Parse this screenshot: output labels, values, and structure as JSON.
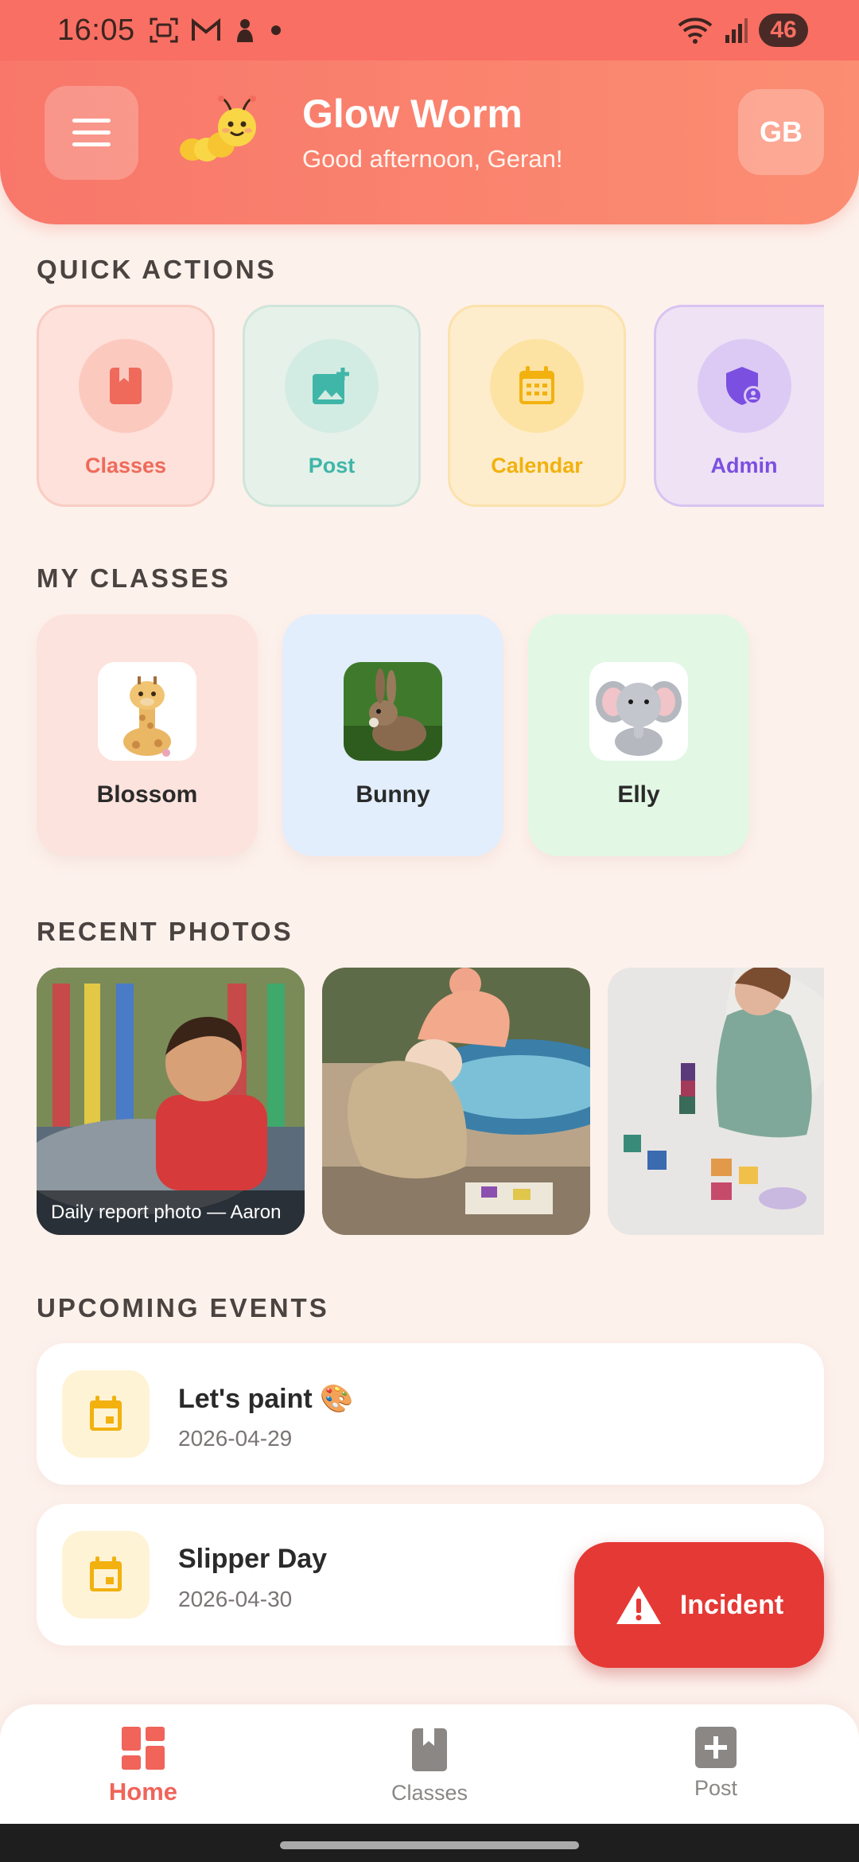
{
  "status": {
    "time": "16:05",
    "battery": "46",
    "icons": [
      "screenshot-icon",
      "gmail-icon",
      "notification-icon",
      "dot-icon",
      "wifi-icon",
      "signal-icon"
    ]
  },
  "header": {
    "app_title": "Glow Worm",
    "greeting": "Good afternoon, Geran!",
    "avatar_initials": "GB"
  },
  "sections": {
    "quick_actions": "QUICK ACTIONS",
    "my_classes": "MY CLASSES",
    "recent_photos": "RECENT PHOTOS",
    "upcoming_events": "UPCOMING EVENTS"
  },
  "quick_actions": [
    {
      "label": "Classes",
      "color": "#ef6a5b",
      "bg": "#fde1da",
      "circle": "#fcc9bf"
    },
    {
      "label": "Post",
      "color": "#3fb6a8",
      "bg": "#e6f1ea",
      "circle": "#d3ece3"
    },
    {
      "label": "Calendar",
      "color": "#f2b10e",
      "bg": "#fdedcd",
      "circle": "#fde3a3"
    },
    {
      "label": "Admin",
      "color": "#7b4fe0",
      "bg": "#eee2f4",
      "circle": "#dccaf5"
    }
  ],
  "classes": [
    {
      "name": "Blossom",
      "bg": "#fde3dd",
      "thumb": "giraffe"
    },
    {
      "name": "Bunny",
      "bg": "#e3eefc",
      "thumb": "rabbit"
    },
    {
      "name": "Elly",
      "bg": "#e2f8e4",
      "thumb": "elephant"
    }
  ],
  "photos": [
    {
      "caption": "Daily report photo — Aaron"
    },
    {
      "caption": ""
    },
    {
      "caption": ""
    }
  ],
  "events": [
    {
      "title": "Let's paint 🎨",
      "date": "2026-04-29"
    },
    {
      "title": "Slipper Day",
      "date": "2026-04-30"
    }
  ],
  "fab": {
    "label": "Incident",
    "color": "#e53935"
  },
  "nav": [
    {
      "label": "Home",
      "active": true
    },
    {
      "label": "Classes",
      "active": false
    },
    {
      "label": "Post",
      "active": false
    }
  ],
  "accent": "#f96f63"
}
